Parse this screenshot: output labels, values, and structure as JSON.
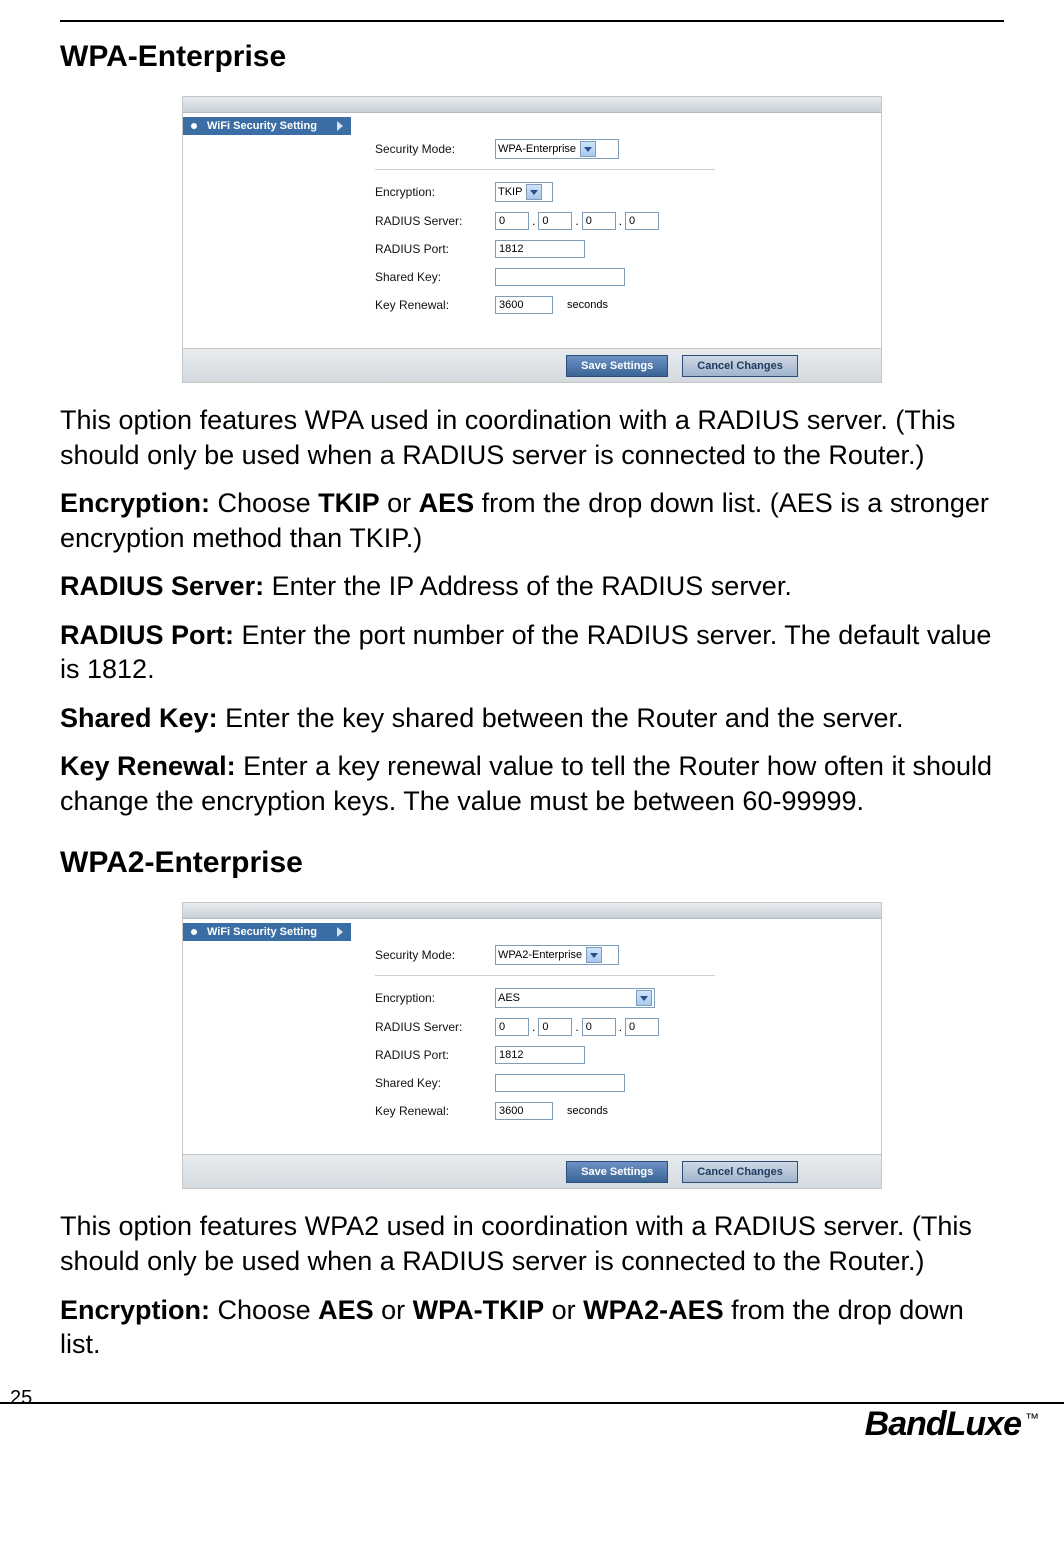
{
  "rules": {
    "top": true
  },
  "sections": {
    "s1": {
      "title": "WPA-Enterprise",
      "panel": {
        "side_label": "WiFi Security Setting",
        "labels": {
          "security_mode": "Security Mode:",
          "encryption": "Encryption:",
          "radius_server": "RADIUS Server:",
          "radius_port": "RADIUS Port:",
          "shared_key": "Shared Key:",
          "key_renewal": "Key Renewal:"
        },
        "values": {
          "security_mode": "WPA-Enterprise",
          "encryption": "TKIP",
          "ip": [
            "0",
            "0",
            "0",
            "0"
          ],
          "radius_port": "1812",
          "shared_key": "",
          "key_renewal": "3600",
          "key_renewal_unit": "seconds"
        },
        "buttons": {
          "save": "Save Settings",
          "cancel": "Cancel Changes"
        }
      },
      "paras": {
        "p1": "This option features WPA used in coordination with a RADIUS server. (This should only be used when a RADIUS server is connected to the Router.)",
        "p2_b": "Encryption:",
        "p2_r1": " Choose ",
        "p2_b2": "TKIP",
        "p2_r2": " or ",
        "p2_b3": "AES",
        "p2_r3": " from the drop down list. (AES is a stronger encryption method than TKIP.)",
        "p3_b": "RADIUS Server:",
        "p3_r": " Enter the IP Address of the RADIUS server.",
        "p4_b": "RADIUS Port:",
        "p4_r": " Enter the port number of the RADIUS server. The default value is 1812.",
        "p5_b": "Shared Key:",
        "p5_r": " Enter the key shared between the Router and the server.",
        "p6_b": "Key Renewal:",
        "p6_r": " Enter a key renewal value to tell the Router how often it should change the encryption keys. The value must be between 60-99999."
      }
    },
    "s2": {
      "title": "WPA2-Enterprise",
      "panel": {
        "side_label": "WiFi Security Setting",
        "labels": {
          "security_mode": "Security Mode:",
          "encryption": "Encryption:",
          "radius_server": "RADIUS Server:",
          "radius_port": "RADIUS Port:",
          "shared_key": "Shared Key:",
          "key_renewal": "Key Renewal:"
        },
        "values": {
          "security_mode": "WPA2-Enterprise",
          "encryption": "AES",
          "ip": [
            "0",
            "0",
            "0",
            "0"
          ],
          "radius_port": "1812",
          "shared_key": "",
          "key_renewal": "3600",
          "key_renewal_unit": "seconds"
        },
        "buttons": {
          "save": "Save Settings",
          "cancel": "Cancel Changes"
        }
      },
      "paras": {
        "p1": "This option features WPA2 used in coordination with a RADIUS server. (This should only be used when a RADIUS server is connected to the Router.)",
        "p2_b": "Encryption:",
        "p2_r1": " Choose ",
        "p2_b2": "AES",
        "p2_r2": " or ",
        "p2_b3": "WPA-TKIP",
        "p2_r3": " or ",
        "p2_b4": "WPA2-AES",
        "p2_r4": " from the drop down list."
      }
    }
  },
  "page_number": "25",
  "brand": {
    "name": "BandLuxe",
    "tm": "™"
  }
}
